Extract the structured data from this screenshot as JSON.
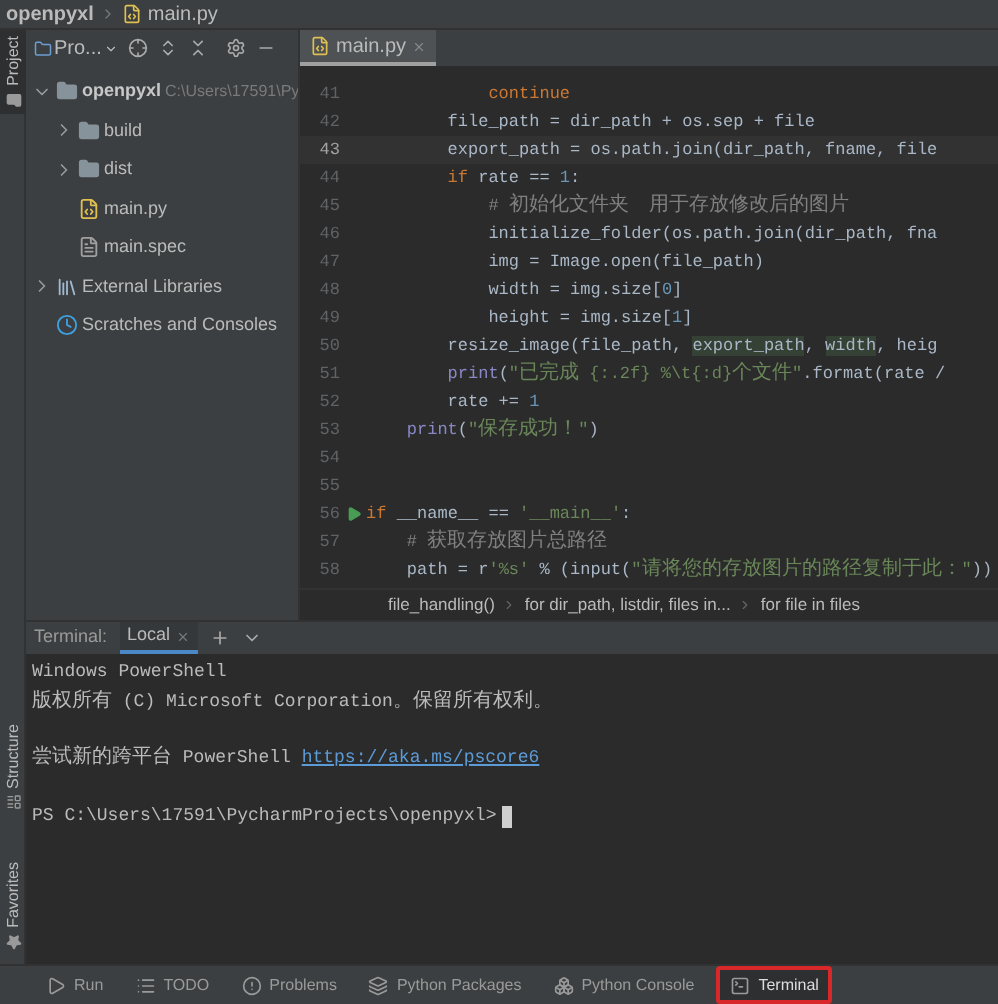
{
  "breadcrumb": [
    "openpyxl",
    "main.py"
  ],
  "left_stripe": [
    {
      "label": "Project",
      "selected": true,
      "kind": "project"
    },
    {
      "label": "Structure",
      "selected": false,
      "kind": "structure"
    },
    {
      "label": "Favorites",
      "selected": false,
      "kind": "favorites"
    }
  ],
  "project_panel": {
    "title": "Pro...",
    "tree": [
      {
        "label": "openpyxl",
        "kind": "folder",
        "path": "C:\\Users\\17591\\Py",
        "expanded": true,
        "children": [
          {
            "label": "build",
            "kind": "folder",
            "expanded": false
          },
          {
            "label": "dist",
            "kind": "folder",
            "expanded": false
          },
          {
            "label": "main.py",
            "kind": "python"
          },
          {
            "label": "main.spec",
            "kind": "spec"
          }
        ]
      },
      {
        "label": "External Libraries",
        "kind": "libraries",
        "expanded": false
      },
      {
        "label": "Scratches and Consoles",
        "kind": "scratches"
      }
    ]
  },
  "editor": {
    "tabs": [
      {
        "label": "main.py",
        "selected": true
      }
    ],
    "lines": [
      {
        "number": "41",
        "current": false,
        "run": false,
        "segments": [
          {
            "text": "            continue",
            "kind": "keyword"
          }
        ]
      },
      {
        "number": "42",
        "current": false,
        "run": false,
        "segments": [
          {
            "text": "        file_path = dir_path + os.sep + file",
            "kind": "plain"
          }
        ]
      },
      {
        "number": "43",
        "current": true,
        "run": false,
        "segments": [
          {
            "text": "        export_path = os.path.join(dir_path, fname, file",
            "kind": "plain"
          }
        ]
      },
      {
        "number": "44",
        "current": false,
        "run": false,
        "segments": [
          {
            "text": "        if ",
            "kind": "keyword"
          },
          {
            "text": "rate == ",
            "kind": "plain"
          },
          {
            "text": "1",
            "kind": "number"
          },
          {
            "text": ":",
            "kind": "plain"
          }
        ]
      },
      {
        "number": "45",
        "current": false,
        "run": false,
        "segments": [
          {
            "text": "            # 初始化文件夹  用于存放修改后的图片",
            "kind": "comment"
          }
        ]
      },
      {
        "number": "46",
        "current": false,
        "run": false,
        "segments": [
          {
            "text": "            initialize_folder(os.path.join(dir_path, fna",
            "kind": "plain"
          }
        ]
      },
      {
        "number": "47",
        "current": false,
        "run": false,
        "segments": [
          {
            "text": "            img = Image.open(file_path)",
            "kind": "plain"
          }
        ]
      },
      {
        "number": "48",
        "current": false,
        "run": false,
        "segments": [
          {
            "text": "            width = img.size[",
            "kind": "plain"
          },
          {
            "text": "0",
            "kind": "number"
          },
          {
            "text": "]",
            "kind": "plain"
          }
        ]
      },
      {
        "number": "49",
        "current": false,
        "run": false,
        "segments": [
          {
            "text": "            height = img.size[",
            "kind": "plain"
          },
          {
            "text": "1",
            "kind": "number"
          },
          {
            "text": "]",
            "kind": "plain"
          }
        ]
      },
      {
        "number": "50",
        "current": false,
        "run": false,
        "segments": [
          {
            "text": "        resize_image(file_path, ",
            "kind": "plain"
          },
          {
            "text": "export_path",
            "kind": "param"
          },
          {
            "text": ", ",
            "kind": "plain"
          },
          {
            "text": "width",
            "kind": "param"
          },
          {
            "text": ", heig",
            "kind": "plain"
          }
        ]
      },
      {
        "number": "51",
        "current": false,
        "run": false,
        "segments": [
          {
            "text": "        print",
            "kind": "builtin"
          },
          {
            "text": "(",
            "kind": "plain"
          },
          {
            "text": "\"已完成 {:.2f} %\\t{:d}个文件\"",
            "kind": "string"
          },
          {
            "text": ".format(rate /",
            "kind": "plain"
          }
        ]
      },
      {
        "number": "52",
        "current": false,
        "run": false,
        "segments": [
          {
            "text": "        rate += ",
            "kind": "plain"
          },
          {
            "text": "1",
            "kind": "number"
          }
        ]
      },
      {
        "number": "53",
        "current": false,
        "run": false,
        "segments": [
          {
            "text": "    print",
            "kind": "builtin"
          },
          {
            "text": "(",
            "kind": "plain"
          },
          {
            "text": "\"保存成功！\"",
            "kind": "string"
          },
          {
            "text": ")",
            "kind": "plain"
          }
        ]
      },
      {
        "number": "54",
        "current": false,
        "run": false
      },
      {
        "number": "55",
        "current": false,
        "run": false
      },
      {
        "number": "56",
        "current": false,
        "run": true,
        "segments": [
          {
            "text": "if ",
            "kind": "keyword"
          },
          {
            "text": "__name__ == ",
            "kind": "plain"
          },
          {
            "text": "'__main__'",
            "kind": "string"
          },
          {
            "text": ":",
            "kind": "plain"
          }
        ]
      },
      {
        "number": "57",
        "current": false,
        "run": false,
        "segments": [
          {
            "text": "    # 获取存放图片总路径",
            "kind": "comment"
          }
        ]
      },
      {
        "number": "58",
        "current": false,
        "run": false,
        "segments": [
          {
            "text": "    path = r",
            "kind": "plain"
          },
          {
            "text": "'%s'",
            "kind": "string"
          },
          {
            "text": " % (input(",
            "kind": "plain"
          },
          {
            "text": "\"请将您的存放图片的路径复制于此：\"",
            "kind": "string"
          },
          {
            "text": "))",
            "kind": "plain"
          }
        ]
      }
    ],
    "breadcrumbs": [
      "file_handling()",
      "for dir_path, listdir, files in...",
      "for file in files"
    ]
  },
  "terminal": {
    "title": "Terminal:",
    "tabs": [
      {
        "label": "Local",
        "selected": true
      }
    ],
    "lines": [
      {
        "kind": "plain",
        "text": "Windows PowerShell"
      },
      {
        "kind": "plain",
        "text": "版权所有 (C) Microsoft Corporation。保留所有权利。"
      },
      {
        "kind": "blank"
      },
      {
        "kind": "link",
        "text": "尝试新的跨平台 PowerShell ",
        "link": "https://aka.ms/pscore6"
      },
      {
        "kind": "blank"
      },
      {
        "kind": "prompt",
        "text": "PS C:\\Users\\17591\\PycharmProjects\\openpyxl>"
      }
    ]
  },
  "tool_windows": [
    {
      "label": "Run",
      "kind": "run",
      "selected": false
    },
    {
      "label": "TODO",
      "kind": "todo",
      "selected": false
    },
    {
      "label": "Problems",
      "kind": "problems",
      "selected": false
    },
    {
      "label": "Python Packages",
      "kind": "packages",
      "selected": false
    },
    {
      "label": "Python Console",
      "kind": "console",
      "selected": false
    },
    {
      "label": "Terminal",
      "kind": "terminal",
      "selected": true
    }
  ]
}
